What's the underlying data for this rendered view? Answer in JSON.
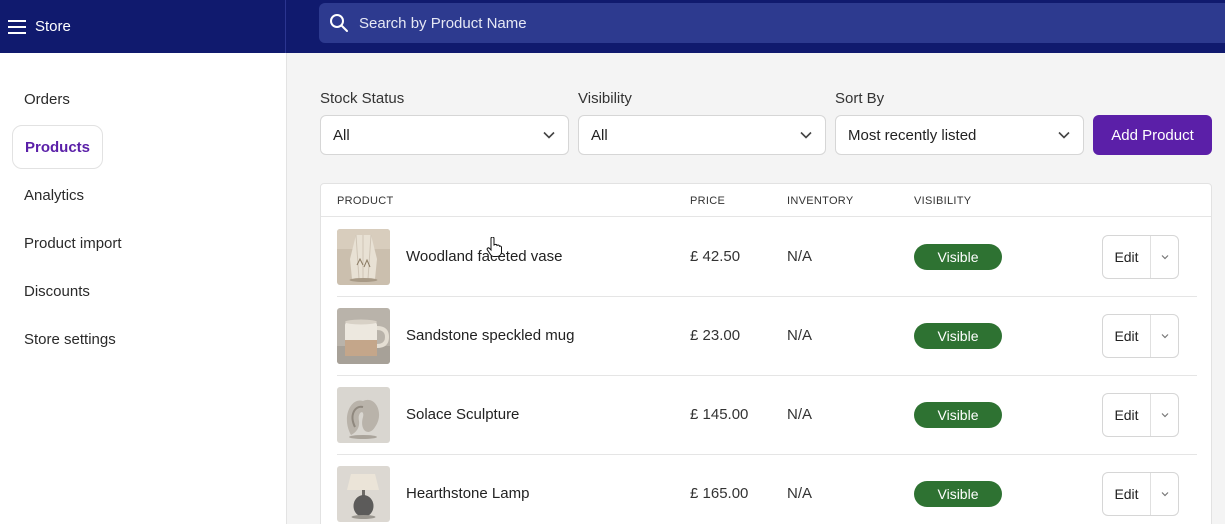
{
  "app": {
    "title": "Store",
    "menu_icon": "hamburger-icon"
  },
  "search": {
    "placeholder": "Search by Product Name",
    "icon": "search-icon"
  },
  "sidebar": {
    "items": [
      {
        "label": "Orders",
        "active": false
      },
      {
        "label": "Products",
        "active": true
      },
      {
        "label": "Analytics",
        "active": false
      },
      {
        "label": "Product import",
        "active": false
      },
      {
        "label": "Discounts",
        "active": false
      },
      {
        "label": "Store settings",
        "active": false
      }
    ]
  },
  "filters": {
    "stock_status": {
      "label": "Stock Status",
      "value": "All"
    },
    "visibility": {
      "label": "Visibility",
      "value": "All"
    },
    "sort_by": {
      "label": "Sort By",
      "value": "Most recently listed"
    }
  },
  "actions": {
    "add_product_label": "Add Product"
  },
  "table": {
    "columns": [
      "PRODUCT",
      "PRICE",
      "INVENTORY",
      "VISIBILITY"
    ],
    "rows": [
      {
        "name": "Woodland faceted vase",
        "price": "£ 42.50",
        "inventory": "N/A",
        "visibility": "Visible",
        "edit": "Edit"
      },
      {
        "name": "Sandstone speckled mug",
        "price": "£ 23.00",
        "inventory": "N/A",
        "visibility": "Visible",
        "edit": "Edit"
      },
      {
        "name": "Solace Sculpture",
        "price": "£ 145.00",
        "inventory": "N/A",
        "visibility": "Visible",
        "edit": "Edit"
      },
      {
        "name": "Hearthstone Lamp",
        "price": "£ 165.00",
        "inventory": "N/A",
        "visibility": "Visible",
        "edit": "Edit"
      }
    ]
  },
  "colors": {
    "topbar": "#101a6e",
    "search_bg": "#2d3a8f",
    "accent": "#5b1fa8",
    "visible_badge": "#2e7232"
  }
}
